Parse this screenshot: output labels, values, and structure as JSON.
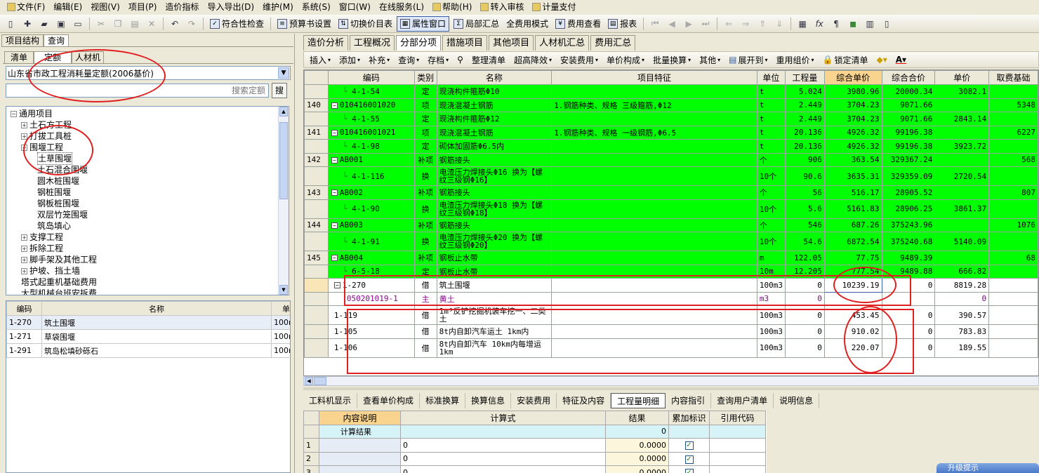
{
  "menu": [
    {
      "icon": "file-icon",
      "label": "文件(F)"
    },
    {
      "label": "编辑(E)"
    },
    {
      "label": "视图(V)"
    },
    {
      "label": "项目(P)"
    },
    {
      "label": "造价指标"
    },
    {
      "label": "导入导出(D)"
    },
    {
      "label": "维护(M)"
    },
    {
      "label": "系统(S)"
    },
    {
      "label": "窗口(W)"
    },
    {
      "label": "在线服务(L)"
    },
    {
      "icon": "help-icon",
      "label": "帮助(H)"
    },
    {
      "icon": "transfer-icon",
      "label": "转入审核"
    },
    {
      "icon": "payment-icon",
      "label": "计量支付"
    }
  ],
  "toolbar": {
    "check": "符合性检查",
    "budget_settings": "预算书设置",
    "switch_price_table": "切换价目表",
    "properties_window": "属性窗口",
    "local_summary": "局部汇总",
    "full_fee_mode": "全费用模式",
    "fee_view": "费用查看",
    "report": "报表"
  },
  "left": {
    "tabs": [
      "项目结构",
      "查询"
    ],
    "subtabs": [
      "清单",
      "定额",
      "人材机"
    ],
    "quota_library": "山东省市政工程消耗量定额(2006基价)",
    "search_placeholder": "搜索定额",
    "search_button": "搜",
    "tree": [
      {
        "label": "通用项目",
        "level": 0,
        "toggle": "−"
      },
      {
        "label": "土石方工程",
        "level": 1,
        "toggle": "+"
      },
      {
        "label": "打拔工具桩",
        "level": 1,
        "toggle": "+"
      },
      {
        "label": "围堰工程",
        "level": 1,
        "toggle": "−"
      },
      {
        "label": "土草围堰",
        "level": 2,
        "selected": true
      },
      {
        "label": "土石混合围堰",
        "level": 2
      },
      {
        "label": "圆木桩围堰",
        "level": 2
      },
      {
        "label": "钢桩围堰",
        "level": 2
      },
      {
        "label": "钢板桩围堰",
        "level": 2
      },
      {
        "label": "双层竹笼围堰",
        "level": 2
      },
      {
        "label": "筑岛填心",
        "level": 2
      },
      {
        "label": "支撑工程",
        "level": 1,
        "toggle": "+"
      },
      {
        "label": "拆除工程",
        "level": 1,
        "toggle": "+"
      },
      {
        "label": "脚手架及其他工程",
        "level": 1,
        "toggle": "+"
      },
      {
        "label": "护坡、挡土墙",
        "level": 1,
        "toggle": "+"
      },
      {
        "label": "塔式起重机基础费用",
        "level": 1
      },
      {
        "label": "大型机械台班安拆费",
        "level": 1
      }
    ],
    "list_headers": [
      "编码",
      "名称",
      "单"
    ],
    "list_rows": [
      {
        "code": "1-270",
        "name": "筑土围堰",
        "unit": "100m"
      },
      {
        "code": "1-271",
        "name": "草袋围堰",
        "unit": "100m"
      },
      {
        "code": "1-291",
        "name": "筑岛松填砂砾石",
        "unit": "100m"
      }
    ]
  },
  "right": {
    "tabs": [
      "造价分析",
      "工程概况",
      "分部分项",
      "措施项目",
      "其他项目",
      "人材机汇总",
      "费用汇总"
    ],
    "active_tab": "分部分项",
    "toolbar": [
      "插入",
      "添加",
      "补充",
      "查询",
      "存档",
      "整理清单",
      "超高降效",
      "安装费用",
      "单价构成",
      "批量换算",
      "其他",
      "展开到",
      "重用组价",
      "锁定清单"
    ],
    "headers": [
      "",
      "编码",
      "类别",
      "名称",
      "项目特征",
      "单位",
      "工程量",
      "综合单价",
      "综合合价",
      "单价",
      "取费基础"
    ],
    "rows": [
      {
        "num": "",
        "code": "4-1-54",
        "type": "定",
        "name": "现浇构件箍筋Φ10",
        "feat": "",
        "unit": "t",
        "qty": "5.024",
        "uprice": "3980.96",
        "total": "20000.34",
        "price": "3082.1",
        "base": "",
        "style": "g",
        "indent": 2
      },
      {
        "num": "140",
        "code": "010416001020",
        "type": "项",
        "name": "现浇混凝土钢筋",
        "feat": "1.钢筋种类、规格 三级箍筋,Φ12",
        "unit": "t",
        "qty": "2.449",
        "uprice": "3704.23",
        "total": "9071.66",
        "price": "",
        "base": "5348",
        "style": "g",
        "indent": 1,
        "toggle": "−"
      },
      {
        "num": "",
        "code": "4-1-55",
        "type": "定",
        "name": "现浇构件箍筋Φ12",
        "feat": "",
        "unit": "t",
        "qty": "2.449",
        "uprice": "3704.23",
        "total": "9071.66",
        "price": "2843.14",
        "base": "",
        "style": "g",
        "indent": 2
      },
      {
        "num": "141",
        "code": "010416001021",
        "type": "项",
        "name": "现浇混凝土钢筋",
        "feat": "1.钢筋种类、规格 一级钢筋,Φ6.5",
        "unit": "t",
        "qty": "20.136",
        "uprice": "4926.32",
        "total": "99196.38",
        "price": "",
        "base": "6227",
        "style": "g",
        "indent": 1,
        "toggle": "−"
      },
      {
        "num": "",
        "code": "4-1-98",
        "type": "定",
        "name": "砌体加固筋Φ6.5内",
        "feat": "",
        "unit": "t",
        "qty": "20.136",
        "uprice": "4926.32",
        "total": "99196.38",
        "price": "3923.72",
        "base": "",
        "style": "g",
        "indent": 2
      },
      {
        "num": "142",
        "code": "AB001",
        "type": "补项",
        "name": "钢筋接头",
        "feat": "",
        "unit": "个",
        "qty": "906",
        "uprice": "363.54",
        "total": "329367.24",
        "price": "",
        "base": "568",
        "style": "g",
        "indent": 1,
        "toggle": "−"
      },
      {
        "num": "",
        "code": "4-1-116",
        "type": "换",
        "name": "电渣压力焊接头Φ16  换为【螺纹三级钢Φ16】",
        "feat": "",
        "unit": "10个",
        "qty": "90.6",
        "uprice": "3635.31",
        "total": "329359.09",
        "price": "2720.54",
        "base": "",
        "style": "g",
        "indent": 2,
        "tall": true
      },
      {
        "num": "143",
        "code": "AB002",
        "type": "补项",
        "name": "钢筋接头",
        "feat": "",
        "unit": "个",
        "qty": "56",
        "uprice": "516.17",
        "total": "28905.52",
        "price": "",
        "base": "807",
        "style": "g",
        "indent": 1,
        "toggle": "−"
      },
      {
        "num": "",
        "code": "4-1-90",
        "type": "换",
        "name": "电渣压力焊接头Φ18  换为【螺纹三级钢Φ18】",
        "feat": "",
        "unit": "10个",
        "qty": "5.6",
        "uprice": "5161.83",
        "total": "28906.25",
        "price": "3861.37",
        "base": "",
        "style": "g",
        "indent": 2,
        "tall": true
      },
      {
        "num": "144",
        "code": "AB003",
        "type": "补项",
        "name": "钢筋接头",
        "feat": "",
        "unit": "个",
        "qty": "546",
        "uprice": "687.26",
        "total": "375243.96",
        "price": "",
        "base": "1076",
        "style": "g",
        "indent": 1,
        "toggle": "−"
      },
      {
        "num": "",
        "code": "4-1-91",
        "type": "换",
        "name": "电渣压力焊接头Φ20  换为【螺纹三级钢Φ20】",
        "feat": "",
        "unit": "10个",
        "qty": "54.6",
        "uprice": "6872.54",
        "total": "375240.68",
        "price": "5140.09",
        "base": "",
        "style": "g",
        "indent": 2,
        "tall": true
      },
      {
        "num": "145",
        "code": "AB004",
        "type": "补项",
        "name": "钢板止水带",
        "feat": "",
        "unit": "m",
        "qty": "122.05",
        "uprice": "77.75",
        "total": "9489.39",
        "price": "",
        "base": "68",
        "style": "g",
        "indent": 1,
        "toggle": "−"
      },
      {
        "num": "",
        "code": "6-5-18",
        "type": "定",
        "name": "钢板止水带",
        "feat": "",
        "unit": "10m",
        "qty": "12.205",
        "uprice": "777.54",
        "total": "9489.88",
        "price": "666.82",
        "base": "",
        "style": "g",
        "indent": 2
      },
      {
        "num": "",
        "code": "1-270",
        "type": "借",
        "name": "筑土围堰",
        "feat": "",
        "unit": "100m3",
        "qty": "0",
        "uprice": "10239.19",
        "total": "0",
        "price": "8819.28",
        "base": "",
        "style": "w",
        "indent": 2,
        "toggle": "−",
        "active": true
      },
      {
        "num": "",
        "code": "050201019-1",
        "type": "主",
        "name": "黄土",
        "feat": "",
        "unit": "m3",
        "qty": "0",
        "uprice": "",
        "total": "",
        "price": "0",
        "base": "",
        "style": "w",
        "indent": 3,
        "purple": true
      },
      {
        "num": "",
        "code": "1-119",
        "type": "借",
        "name": "1m³反铲挖掘机装车挖一、二类土",
        "feat": "",
        "unit": "100m3",
        "qty": "0",
        "uprice": "453.45",
        "total": "0",
        "price": "390.57",
        "base": "",
        "style": "w",
        "indent": 2,
        "tall": true
      },
      {
        "num": "",
        "code": "1-105",
        "type": "借",
        "name": "8t内自卸汽车运土 1km内",
        "feat": "",
        "unit": "100m3",
        "qty": "0",
        "uprice": "910.02",
        "total": "0",
        "price": "783.83",
        "base": "",
        "style": "w",
        "indent": 2
      },
      {
        "num": "",
        "code": "1-106",
        "type": "借",
        "name": "8t内自卸汽车 10km内每增运1km",
        "feat": "",
        "unit": "100m3",
        "qty": "0",
        "uprice": "220.07",
        "total": "0",
        "price": "189.55",
        "base": "",
        "style": "w",
        "indent": 2,
        "tall": true
      }
    ],
    "bottom_tabs": [
      "工料机显示",
      "查看单价构成",
      "标准换算",
      "换算信息",
      "安装费用",
      "特征及内容",
      "工程量明细",
      "内容指引",
      "查询用户清单",
      "说明信息"
    ],
    "active_bottom_tab": "工程量明细",
    "bottom_headers": [
      "",
      "内容说明",
      "计算式",
      "结果",
      "累加标识",
      "引用代码"
    ],
    "bottom_rows": [
      {
        "num": "",
        "desc": "计算结果",
        "formula": "",
        "result": "0",
        "flag": false,
        "ref": "",
        "header_row": true
      },
      {
        "num": "1",
        "desc": "",
        "formula": "0",
        "result": "0.0000",
        "flag": true,
        "ref": ""
      },
      {
        "num": "2",
        "desc": "",
        "formula": "0",
        "result": "0.0000",
        "flag": true,
        "ref": ""
      },
      {
        "num": "3",
        "desc": "",
        "formula": "0",
        "result": "0.0000",
        "flag": true,
        "ref": ""
      }
    ]
  },
  "upgrade_tip": "升级提示",
  "colors": {
    "highlight_green": "#00ff00",
    "annotation_red": "#e02020",
    "header_orange": "#f9d48e"
  }
}
